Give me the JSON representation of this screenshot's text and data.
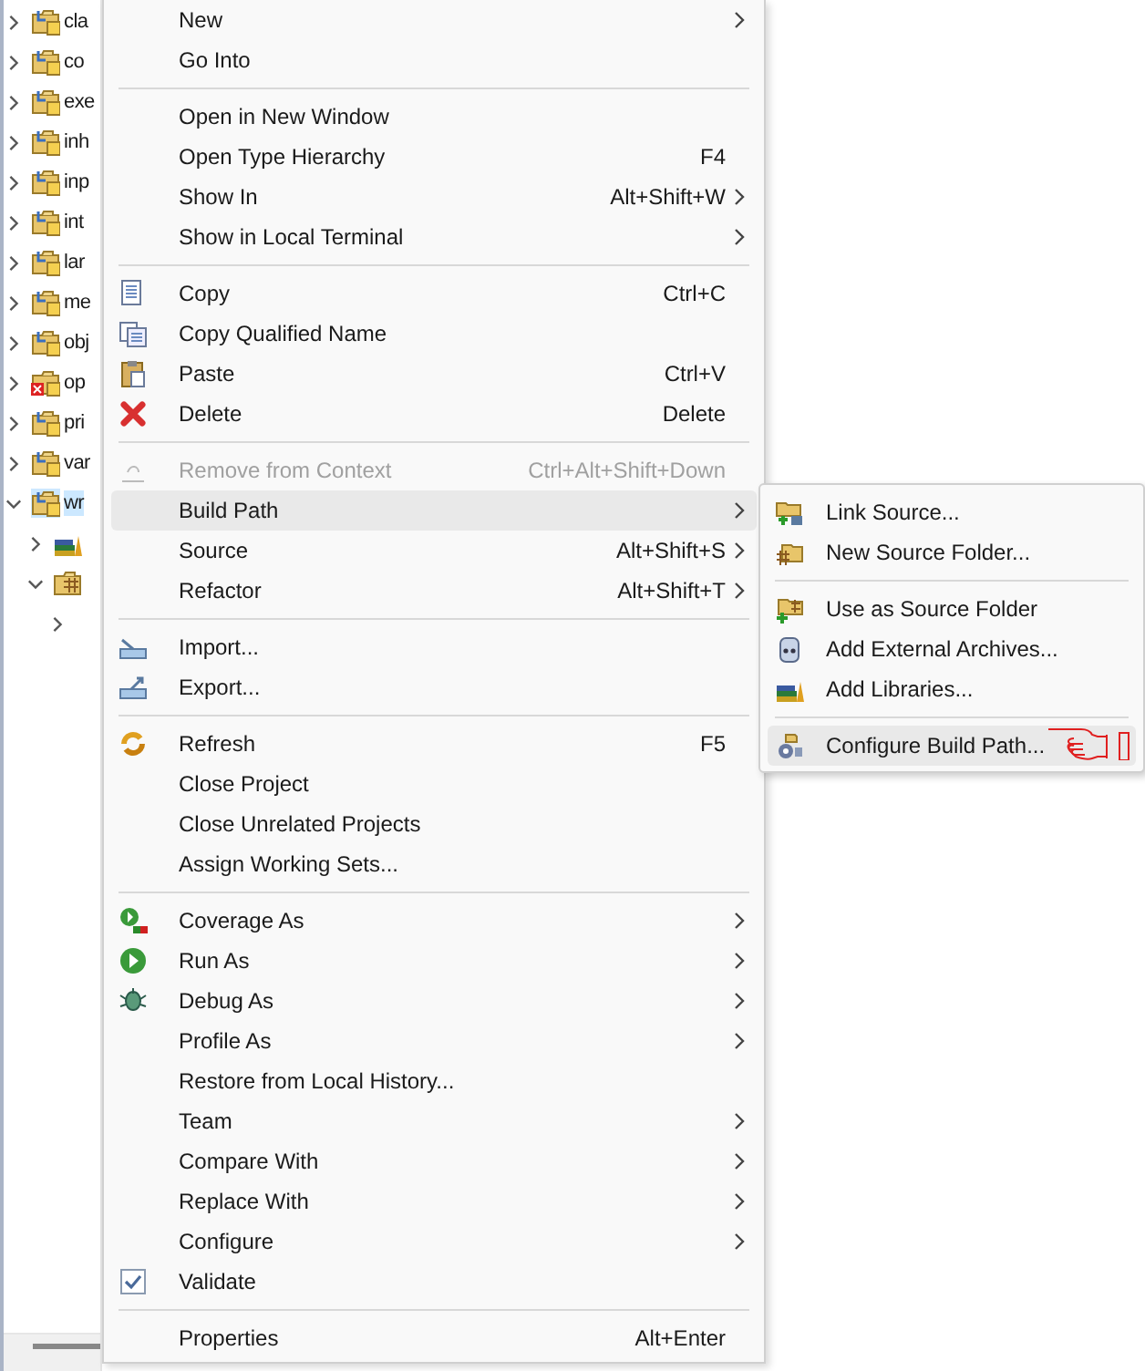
{
  "tree": {
    "items": [
      {
        "label": "cla",
        "kind": "project",
        "expanded": false,
        "selected": false
      },
      {
        "label": "co",
        "kind": "project",
        "expanded": false,
        "selected": false
      },
      {
        "label": "exe",
        "kind": "project",
        "expanded": false,
        "selected": false
      },
      {
        "label": "inh",
        "kind": "project",
        "expanded": false,
        "selected": false
      },
      {
        "label": "inp",
        "kind": "project",
        "expanded": false,
        "selected": false
      },
      {
        "label": "int",
        "kind": "project",
        "expanded": false,
        "selected": false
      },
      {
        "label": "lar",
        "kind": "project",
        "expanded": false,
        "selected": false
      },
      {
        "label": "me",
        "kind": "project",
        "expanded": false,
        "selected": false
      },
      {
        "label": "obj",
        "kind": "project",
        "expanded": false,
        "selected": false
      },
      {
        "label": "op",
        "kind": "project-error",
        "expanded": false,
        "selected": false
      },
      {
        "label": "pri",
        "kind": "project",
        "expanded": false,
        "selected": false
      },
      {
        "label": "var",
        "kind": "project",
        "expanded": false,
        "selected": false
      },
      {
        "label": "wr",
        "kind": "project",
        "expanded": true,
        "selected": true,
        "children": [
          {
            "kind": "library",
            "expanded": false
          },
          {
            "kind": "source-folder",
            "expanded": true,
            "children": [
              {
                "expanded": false
              }
            ]
          }
        ]
      }
    ]
  },
  "context_menu": {
    "items": [
      {
        "kind": "item",
        "label": "New",
        "submenu": true,
        "disabled": false,
        "selected": false
      },
      {
        "kind": "item",
        "label": "Go Into",
        "submenu": false,
        "disabled": false,
        "selected": false
      },
      {
        "kind": "separator"
      },
      {
        "kind": "item",
        "label": "Open in New Window",
        "submenu": false,
        "disabled": false,
        "selected": false
      },
      {
        "kind": "item",
        "label": "Open Type Hierarchy",
        "shortcut": "F4",
        "submenu": false,
        "disabled": false,
        "selected": false
      },
      {
        "kind": "item",
        "label": "Show In",
        "shortcut": "Alt+Shift+W",
        "submenu": true,
        "disabled": false,
        "selected": false
      },
      {
        "kind": "item",
        "label": "Show in Local Terminal",
        "submenu": true,
        "disabled": false,
        "selected": false
      },
      {
        "kind": "separator"
      },
      {
        "kind": "item",
        "label": "Copy",
        "shortcut": "Ctrl+C",
        "submenu": false,
        "disabled": false,
        "selected": false
      },
      {
        "kind": "item",
        "label": "Copy Qualified Name",
        "submenu": false,
        "disabled": false,
        "selected": false
      },
      {
        "kind": "item",
        "label": "Paste",
        "shortcut": "Ctrl+V",
        "submenu": false,
        "disabled": false,
        "selected": false
      },
      {
        "kind": "item",
        "label": "Delete",
        "shortcut": "Delete",
        "submenu": false,
        "disabled": false,
        "selected": false
      },
      {
        "kind": "separator"
      },
      {
        "kind": "item",
        "label": "Remove from Context",
        "shortcut": "Ctrl+Alt+Shift+Down",
        "submenu": false,
        "disabled": true,
        "selected": false
      },
      {
        "kind": "item",
        "label": "Build Path",
        "submenu": true,
        "disabled": false,
        "selected": true
      },
      {
        "kind": "item",
        "label": "Source",
        "shortcut": "Alt+Shift+S",
        "submenu": true,
        "disabled": false,
        "selected": false
      },
      {
        "kind": "item",
        "label": "Refactor",
        "shortcut": "Alt+Shift+T",
        "submenu": true,
        "disabled": false,
        "selected": false
      },
      {
        "kind": "separator"
      },
      {
        "kind": "item",
        "label": "Import...",
        "submenu": false,
        "disabled": false,
        "selected": false
      },
      {
        "kind": "item",
        "label": "Export...",
        "submenu": false,
        "disabled": false,
        "selected": false
      },
      {
        "kind": "separator"
      },
      {
        "kind": "item",
        "label": "Refresh",
        "shortcut": "F5",
        "submenu": false,
        "disabled": false,
        "selected": false
      },
      {
        "kind": "item",
        "label": "Close Project",
        "submenu": false,
        "disabled": false,
        "selected": false
      },
      {
        "kind": "item",
        "label": "Close Unrelated Projects",
        "submenu": false,
        "disabled": false,
        "selected": false
      },
      {
        "kind": "item",
        "label": "Assign Working Sets...",
        "submenu": false,
        "disabled": false,
        "selected": false
      },
      {
        "kind": "separator"
      },
      {
        "kind": "item",
        "label": "Coverage As",
        "submenu": true,
        "disabled": false,
        "selected": false
      },
      {
        "kind": "item",
        "label": "Run As",
        "submenu": true,
        "disabled": false,
        "selected": false
      },
      {
        "kind": "item",
        "label": "Debug As",
        "submenu": true,
        "disabled": false,
        "selected": false
      },
      {
        "kind": "item",
        "label": "Profile As",
        "submenu": true,
        "disabled": false,
        "selected": false
      },
      {
        "kind": "item",
        "label": "Restore from Local History...",
        "submenu": false,
        "disabled": false,
        "selected": false
      },
      {
        "kind": "item",
        "label": "Team",
        "submenu": true,
        "disabled": false,
        "selected": false
      },
      {
        "kind": "item",
        "label": "Compare With",
        "submenu": true,
        "disabled": false,
        "selected": false
      },
      {
        "kind": "item",
        "label": "Replace With",
        "submenu": true,
        "disabled": false,
        "selected": false
      },
      {
        "kind": "item",
        "label": "Configure",
        "submenu": true,
        "disabled": false,
        "selected": false
      },
      {
        "kind": "item",
        "label": "Validate",
        "submenu": false,
        "disabled": false,
        "selected": false
      },
      {
        "kind": "separator"
      },
      {
        "kind": "item",
        "label": "Properties",
        "shortcut": "Alt+Enter",
        "submenu": false,
        "disabled": false,
        "selected": false
      }
    ]
  },
  "build_path_submenu": {
    "items": [
      {
        "kind": "item",
        "label": "Link Source...",
        "selected": false
      },
      {
        "kind": "item",
        "label": "New Source Folder...",
        "selected": false
      },
      {
        "kind": "separator"
      },
      {
        "kind": "item",
        "label": "Use as Source Folder",
        "selected": false
      },
      {
        "kind": "item",
        "label": "Add External Archives...",
        "selected": false
      },
      {
        "kind": "item",
        "label": "Add Libraries...",
        "selected": false
      },
      {
        "kind": "separator"
      },
      {
        "kind": "item",
        "label": "Configure Build Path...",
        "selected": true
      }
    ]
  }
}
